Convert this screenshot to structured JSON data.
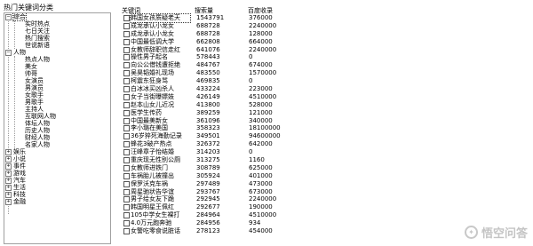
{
  "window": {
    "title": "热门关键词分类"
  },
  "tree": {
    "nodes": [
      {
        "label": "综合",
        "toggle": "−",
        "level": 1,
        "selected": true
      },
      {
        "label": "实时热点",
        "level": 2
      },
      {
        "label": "七日关注",
        "level": 2
      },
      {
        "label": "热门搜索",
        "level": 2
      },
      {
        "label": "世说新语",
        "level": 2
      },
      {
        "label": "人物",
        "toggle": "−",
        "level": 1
      },
      {
        "label": "热点人物",
        "level": 2
      },
      {
        "label": "美女",
        "level": 2
      },
      {
        "label": "帅哥",
        "level": 2
      },
      {
        "label": "女演员",
        "level": 2
      },
      {
        "label": "男演员",
        "level": 2
      },
      {
        "label": "女歌手",
        "level": 2
      },
      {
        "label": "男歌手",
        "level": 2
      },
      {
        "label": "主持人",
        "level": 2
      },
      {
        "label": "互联网人物",
        "level": 2
      },
      {
        "label": "体坛人物",
        "level": 2
      },
      {
        "label": "历史人物",
        "level": 2
      },
      {
        "label": "财经人物",
        "level": 2
      },
      {
        "label": "名家人物",
        "level": 2
      },
      {
        "label": "娱乐",
        "toggle": "+",
        "level": 1
      },
      {
        "label": "小说",
        "toggle": "+",
        "level": 1
      },
      {
        "label": "事件",
        "toggle": "+",
        "level": 1
      },
      {
        "label": "游戏",
        "toggle": "+",
        "level": 1
      },
      {
        "label": "汽车",
        "toggle": "+",
        "level": 1
      },
      {
        "label": "生活",
        "toggle": "+",
        "level": 1
      },
      {
        "label": "科技",
        "toggle": "+",
        "level": 1
      },
      {
        "label": "金融",
        "toggle": "+",
        "level": 1
      }
    ]
  },
  "grid": {
    "columns": {
      "keyword": "关键词",
      "search": "搜索量",
      "baidu": "百度收录"
    },
    "rows": [
      {
        "keyword": "韩国女孩质疑老天",
        "search": "1543791",
        "baidu": "376000",
        "selected": true
      },
      {
        "keyword": "成龙承认小龙女",
        "search": "688728",
        "baidu": "2240000"
      },
      {
        "keyword": "成龙承认小龙女",
        "search": "688728",
        "baidu": "128000"
      },
      {
        "keyword": "中国最低调大学",
        "search": "662808",
        "baidu": "664000"
      },
      {
        "keyword": "女教师辞职信走红",
        "search": "641076",
        "baidu": "2240000"
      },
      {
        "keyword": "操性男子起名",
        "search": "578443",
        "baidu": "0"
      },
      {
        "keyword": "向公公借钱遭拒绝",
        "search": "484767",
        "baidu": "674000"
      },
      {
        "keyword": "吴昊韬婚礼现场",
        "search": "483550",
        "baidu": "1570000"
      },
      {
        "keyword": "柯震东狂身骂",
        "search": "469835",
        "baidu": "0"
      },
      {
        "keyword": "白冰冰买凶杀人",
        "search": "433224",
        "baidu": "223000"
      },
      {
        "keyword": "女子当街曝嫖妓",
        "search": "426149",
        "baidu": "4510000"
      },
      {
        "keyword": "赵本山女儿近况",
        "search": "413800",
        "baidu": "528000"
      },
      {
        "keyword": "医学生传药",
        "search": "389259",
        "baidu": "121000"
      },
      {
        "keyword": "中国最美新女",
        "search": "361096",
        "baidu": "340000"
      },
      {
        "keyword": "李小璐在美国",
        "search": "358323",
        "baidu": "18100000"
      },
      {
        "keyword": "36岁猝死海勤记录",
        "search": "349501",
        "baidu": "94600000"
      },
      {
        "keyword": "蜂花3破产热点",
        "search": "326372",
        "baidu": "642000"
      },
      {
        "keyword": "汪峰章子怡结婚",
        "search": "314203",
        "baidu": "0"
      },
      {
        "keyword": "重庆现无性别公厕",
        "search": "313275",
        "baidu": "1160"
      },
      {
        "keyword": "女教师进铁门",
        "search": "308789",
        "baidu": "625000"
      },
      {
        "keyword": "车祸胎儿被撞出",
        "search": "305924",
        "baidu": "401000"
      },
      {
        "keyword": "保罗沃克车祸",
        "search": "297489",
        "baidu": "473000"
      },
      {
        "keyword": "周星驰状告华谊",
        "search": "293767",
        "baidu": "673000"
      },
      {
        "keyword": "男子给女友下跪",
        "search": "292945",
        "baidu": "2240000"
      },
      {
        "keyword": "韩国明星王佩红",
        "search": "292677",
        "baidu": "190000"
      },
      {
        "keyword": "105中学女生裸打",
        "search": "284964",
        "baidu": "4510000"
      },
      {
        "keyword": "4.0万元跑奔驰",
        "search": "284956",
        "baidu": "934"
      },
      {
        "keyword": "女警吃零食说脏话",
        "search": "278123",
        "baidu": "454000"
      }
    ]
  },
  "watermark": {
    "text": "悟空问答"
  }
}
